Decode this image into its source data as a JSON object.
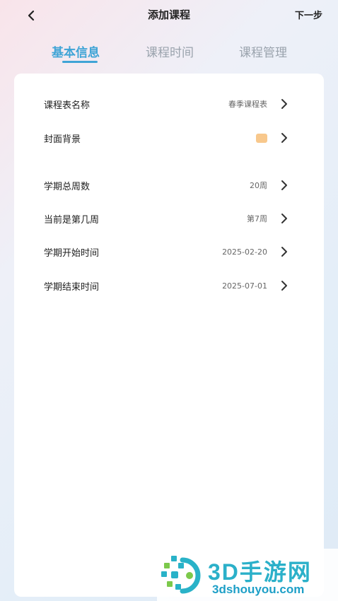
{
  "header": {
    "title": "添加课程",
    "next_label": "下一步"
  },
  "tabs": [
    {
      "label": "基本信息",
      "active": true
    },
    {
      "label": "课程时间",
      "active": false
    },
    {
      "label": "课程管理",
      "active": false
    }
  ],
  "rows": [
    {
      "label": "课程表名称",
      "value": "春季课程表"
    },
    {
      "label": "封面背景",
      "value": "",
      "swatch_color": "#f8c88c"
    },
    {
      "label": "学期总周数",
      "value": "20周"
    },
    {
      "label": "当前是第几周",
      "value": "第7周"
    },
    {
      "label": "学期开始时间",
      "value": "2025-02-20"
    },
    {
      "label": "学期结束时间",
      "value": "2025-07-01"
    }
  ],
  "watermark": {
    "title": "3D手游网",
    "subtitle": "3dshouyou.com"
  },
  "colors": {
    "accent": "#3fa4d6",
    "tab_inactive": "#9aa3ad",
    "watermark": "#2bb0c9"
  },
  "icons": {
    "back": "chevron-left-icon",
    "row_arrow": "chevron-right-icon"
  }
}
